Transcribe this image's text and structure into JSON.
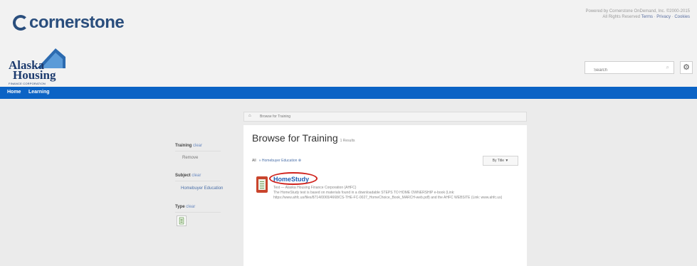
{
  "brand": {
    "name": "cornerstone"
  },
  "powered_by": {
    "line1": "Powered by Cornerstone OnDemand, Inc. ©2000-2015",
    "line2_prefix": "All Rights Reserved",
    "terms": "Terms",
    "privacy": "Privacy",
    "cookies": "Cookies"
  },
  "org_logo": {
    "word1": "Alaska",
    "word2": "Housing",
    "word3": "FINANCE CORPORATION"
  },
  "search": {
    "placeholder": "Search",
    "icon": "search-icon"
  },
  "settings": {
    "icon": "gear-icon"
  },
  "nav": {
    "items": [
      {
        "label": "Home"
      },
      {
        "label": "Learning"
      }
    ]
  },
  "breadcrumb": {
    "home_icon": "home-icon",
    "label": "Browse for Training"
  },
  "sidebar": {
    "training": {
      "title": "Training",
      "clear": "clear",
      "value": "Remove"
    },
    "subject": {
      "title": "Subject",
      "clear": "clear",
      "value": "Homebuyer Education"
    },
    "type": {
      "title": "Type",
      "clear": "clear",
      "icon": "document-type-icon"
    }
  },
  "content": {
    "title": "Browse for Training",
    "results": "1 Results",
    "filter_all": "All",
    "filter_item": "» Homebuyer Education ⊗",
    "sort_label": "By Title ▼"
  },
  "result": {
    "title": "HomeStudy",
    "subtitle": "Test — Alaska Housing Finance Corporation (AHFC)",
    "description": "The HomeStudy test is based on materials found in a downloadable STEPS TO HOME OWNERSHIP e-book (Link: https://www.ahfc.us/files/8714/0065/4668/CS-THE-FC-0027_HomeChoice_Book_MARCH-web.pdf) and the AHFC WEBSITE (Link: www.ahfc.us)",
    "thumb_icon": "document-icon",
    "highlight_color": "#d0231d"
  },
  "colors": {
    "nav": "#0b63c5",
    "brand": "#2a4e7d",
    "link": "#1f5fb5"
  }
}
